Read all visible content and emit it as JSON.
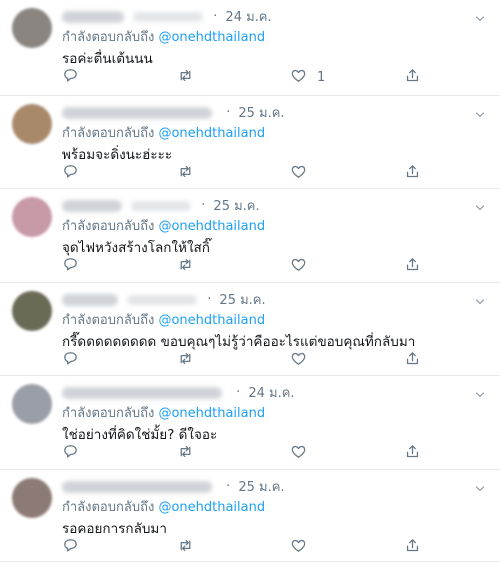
{
  "reply_label": "กำลังตอบกลับถึง",
  "mention": "@onehdthailand",
  "colors": {
    "accent": "#1da1f2",
    "muted": "#657786",
    "text": "#14171a",
    "divider": "#e6ecf0"
  },
  "icons": {
    "reply": "reply-icon",
    "retweet": "retweet-icon",
    "like": "heart-icon",
    "share": "share-icon",
    "menu": "chevron-down-icon"
  },
  "tweets": [
    {
      "time": "24 ม.ค.",
      "text": "รอค่ะตื่นเต้นนน",
      "like_count": "1"
    },
    {
      "time": "25 ม.ค.",
      "text": "พร้อมจะดิ่งนะฮ่ะะะ",
      "like_count": ""
    },
    {
      "time": "25 ม.ค.",
      "text": "จุดไฟหวังสร้างโลกให้ใสกิ๊",
      "like_count": ""
    },
    {
      "time": "25 ม.ค.",
      "text": "กรี๊ดดดดดดดดด ขอบคุณๆไม่รู้ว่าคืออะไรแต่ขอบคุณที่กลับมา",
      "like_count": ""
    },
    {
      "time": "24 ม.ค.",
      "text": "ใช่อย่างที่คิดใช่มั้ย? ดีใจอะ",
      "like_count": ""
    },
    {
      "time": "25 ม.ค.",
      "text": "รอคอยการกลับมา",
      "like_count": ""
    }
  ]
}
